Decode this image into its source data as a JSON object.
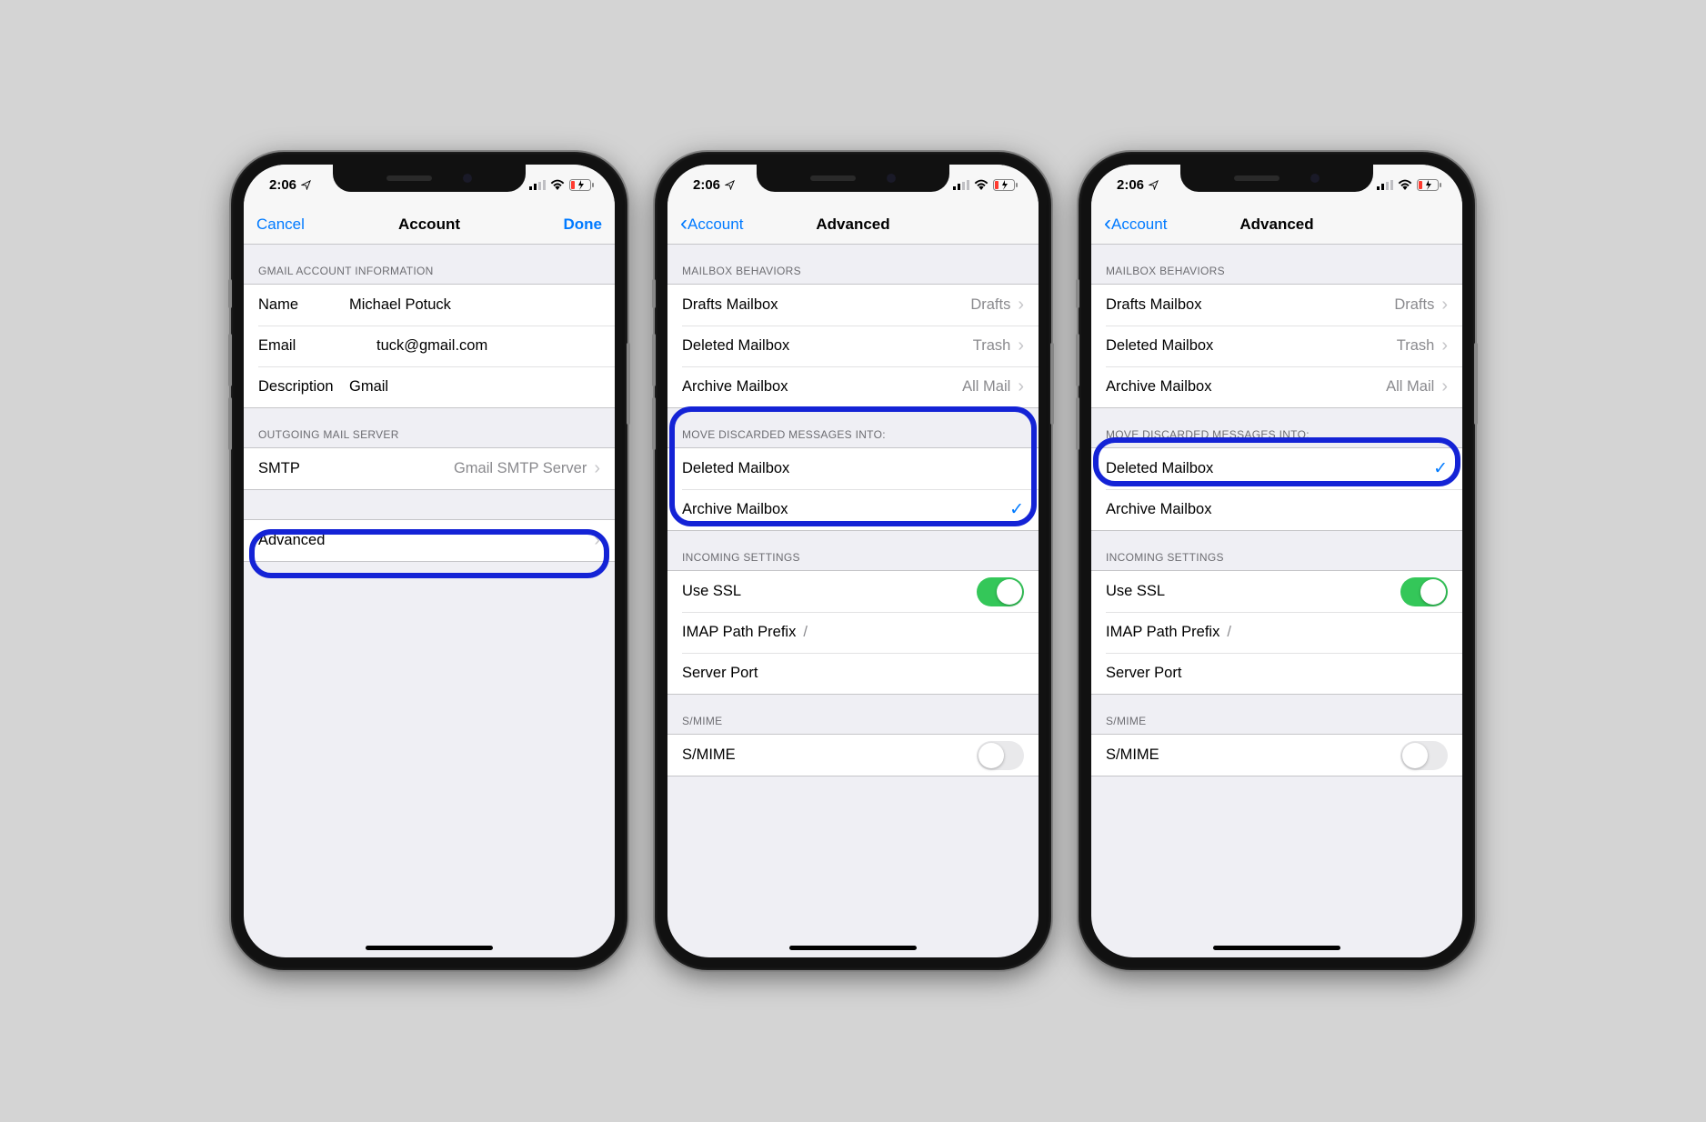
{
  "status": {
    "time": "2:06",
    "location_glyph": "➤",
    "signal_bars": 2,
    "wifi_bars": 3,
    "battery_low": true
  },
  "screen1": {
    "nav": {
      "left": "Cancel",
      "title": "Account",
      "right": "Done"
    },
    "section1_header": "Gmail Account Information",
    "rows1": {
      "name_label": "Name",
      "name_value": "Michael Potuck",
      "email_label": "Email",
      "email_value": "tuck@gmail.com",
      "desc_label": "Description",
      "desc_value": "Gmail"
    },
    "section2_header": "Outgoing Mail Server",
    "smtp_label": "SMTP",
    "smtp_value": "Gmail SMTP Server",
    "advanced_label": "Advanced"
  },
  "advanced": {
    "nav": {
      "back": "Account",
      "title": "Advanced"
    },
    "mb_header": "Mailbox Behaviors",
    "mb": {
      "drafts_l": "Drafts Mailbox",
      "drafts_v": "Drafts",
      "deleted_l": "Deleted Mailbox",
      "deleted_v": "Trash",
      "archive_l": "Archive Mailbox",
      "archive_v": "All Mail"
    },
    "discard_header": "Move Discarded Messages Into:",
    "discard": {
      "deleted": "Deleted Mailbox",
      "archive": "Archive Mailbox"
    },
    "incoming_header": "Incoming Settings",
    "incoming": {
      "ssl": "Use SSL",
      "imap": "IMAP Path Prefix",
      "imap_v": "/",
      "port": "Server Port"
    },
    "smime_header": "S/MIME",
    "smime_row": "S/MIME"
  },
  "screen2_selected": "archive",
  "screen3_selected": "deleted"
}
